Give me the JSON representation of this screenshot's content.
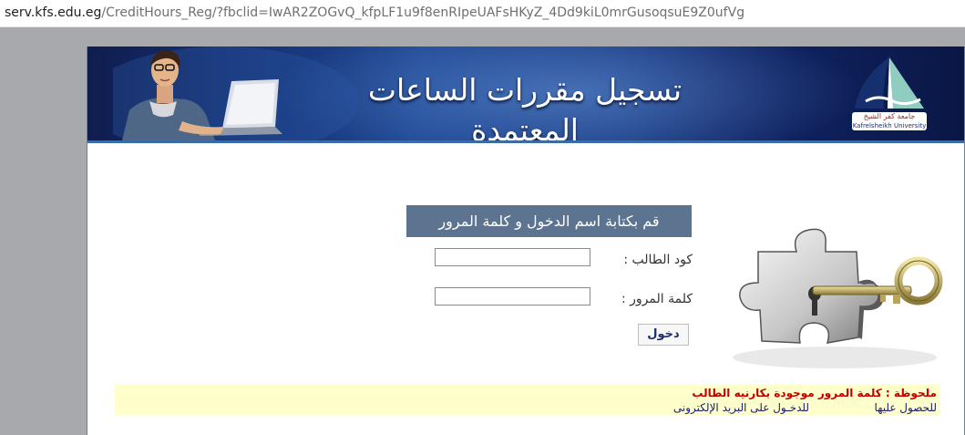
{
  "browser": {
    "url_host": "serv.kfs.edu.eg",
    "url_path": "/CreditHours_Reg/?fbclid=IwAR2ZOGvQ_kfpLF1u9f8enRIpeUAFsHKyZ_4Dd9kiL0mrGusoqsuE9Z0ufVg"
  },
  "banner": {
    "title": "تسجيل مقررات الساعات المعتمدة",
    "logo_text_ar": "جامعة كفر الشيخ",
    "logo_text_en": "Kafrelsheikh University"
  },
  "login": {
    "header": "قم بكتابة اسم الدخول و كلمة المرور",
    "student_code_label": "كود الطالب :",
    "student_code_value": "",
    "password_label": "كلمة المرور :",
    "password_value": "",
    "submit_label": "دخول"
  },
  "notice": {
    "line1": "ملحوظة : كلمة المرور موجودة بكارنيه الطالب",
    "line2_part1": "للحصول عليها",
    "line2_part2": "للدخـول على البريد الإلكترونى"
  },
  "colors": {
    "banner_dark": "#0f1d4e",
    "login_header_bg": "#5d7490",
    "notice_bg": "#ffffcc",
    "notice_red": "#c00000",
    "notice_blue": "#1a1a6e",
    "page_backdrop": "#a7a9ac"
  }
}
